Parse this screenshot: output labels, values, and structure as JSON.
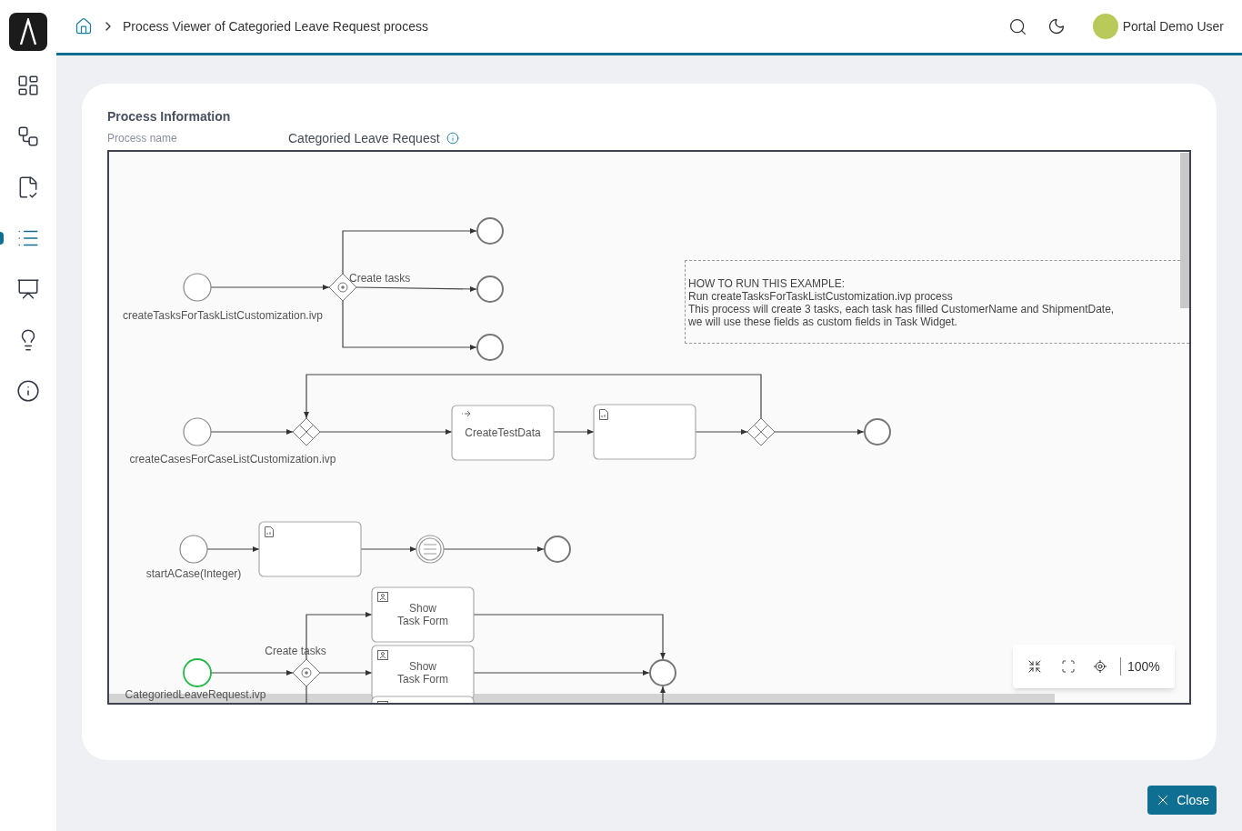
{
  "header": {
    "breadcrumb": "Process Viewer of Categoried Leave Request process",
    "user_name": "Portal Demo User"
  },
  "sidebar": {
    "items": [
      {
        "selected": false
      },
      {
        "selected": false
      },
      {
        "selected": false
      },
      {
        "selected": true
      },
      {
        "selected": false
      },
      {
        "selected": false
      },
      {
        "selected": false
      }
    ]
  },
  "process_information": {
    "heading": "Process Information",
    "field_label": "Process name",
    "field_value": "Categoried Leave Request"
  },
  "diagram": {
    "start_events": [
      {
        "label": "createTasksForTaskListCustomization.ivp",
        "highlighted": false
      },
      {
        "label": "createCasesForCaseListCustomization.ivp",
        "highlighted": false
      },
      {
        "label": "startACase(Integer)",
        "highlighted": false
      },
      {
        "label": "CategoriedLeaveRequest.ivp",
        "highlighted": true
      }
    ],
    "gateway_labels": [
      "Create tasks",
      "Create tasks"
    ],
    "tasks": [
      {
        "kind": "call",
        "label_lines": [
          "CreateTestData"
        ]
      },
      {
        "kind": "script"
      },
      {
        "kind": "script"
      },
      {
        "kind": "user",
        "label_lines": [
          "Show",
          "Task Form"
        ]
      },
      {
        "kind": "user",
        "label_lines": [
          "Show",
          "Task Form"
        ]
      },
      {
        "kind": "user"
      }
    ],
    "note_lines": [
      "HOW TO RUN THIS EXAMPLE:",
      "Run createTasksForTaskListCustomization.ivp process",
      "This process will create 3 tasks, each task has filled CustomerName and ShipmentDate,",
      "we will use these fields as custom fields in Task Widget."
    ],
    "zoom": "100%"
  },
  "close_button": "Close"
}
